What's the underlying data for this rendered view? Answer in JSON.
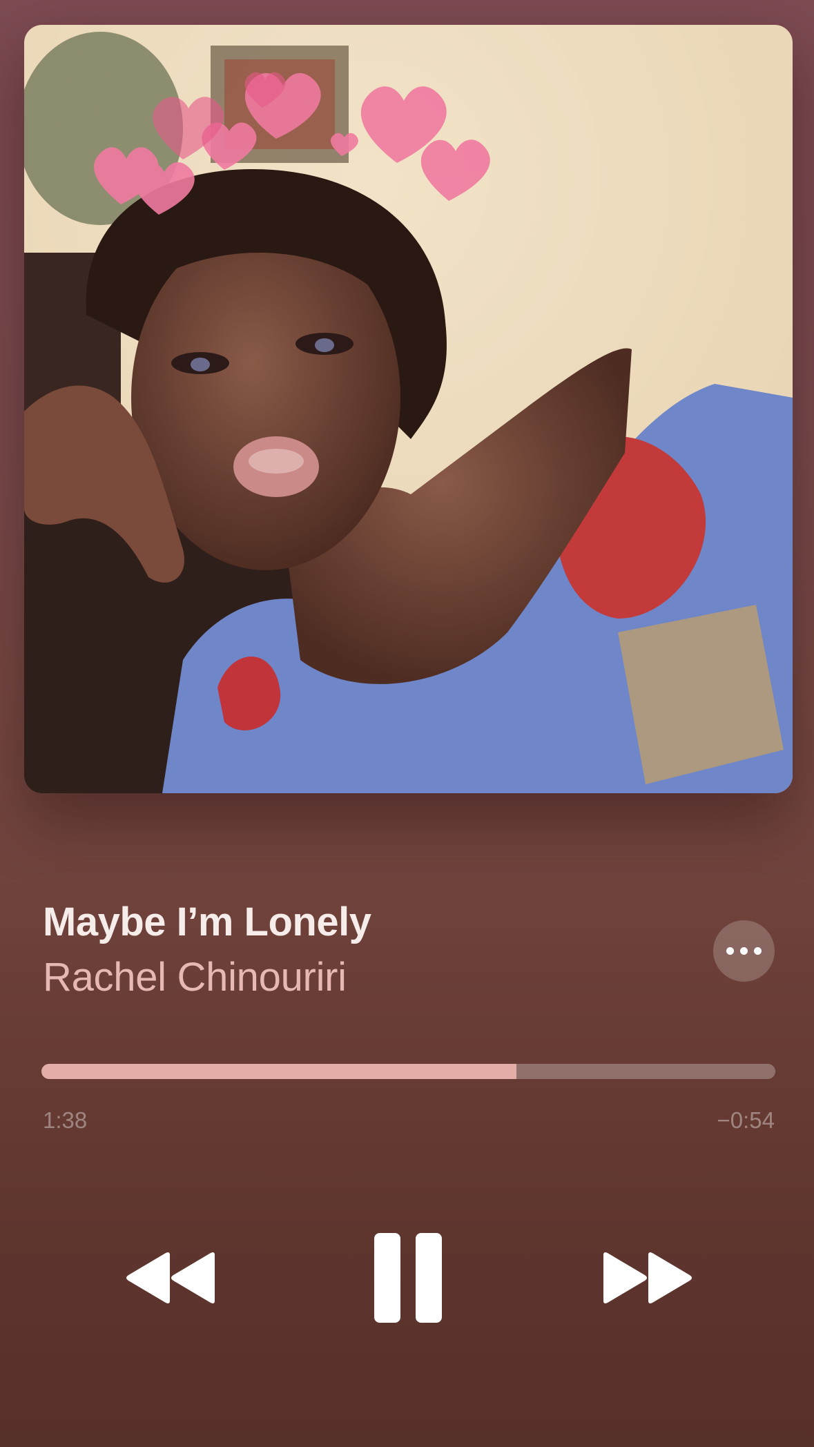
{
  "now_playing": {
    "title": "Maybe I’m Lonely",
    "artist": "Rachel Chinouriri",
    "artwork_icon": "album-artwork",
    "more_icon": "ellipsis-icon"
  },
  "progress": {
    "elapsed": "1:38",
    "remaining": "−0:54",
    "fraction": 0.647
  },
  "controls": {
    "rewind_icon": "rewind-icon",
    "pause_icon": "pause-icon",
    "forward_icon": "fast-forward-icon"
  },
  "colors": {
    "background_top": "#7d4a52",
    "background_bottom": "#56302a",
    "title": "#f6ecea",
    "artist": "#e8b9b4",
    "progress_fill": "#e2aea7"
  }
}
